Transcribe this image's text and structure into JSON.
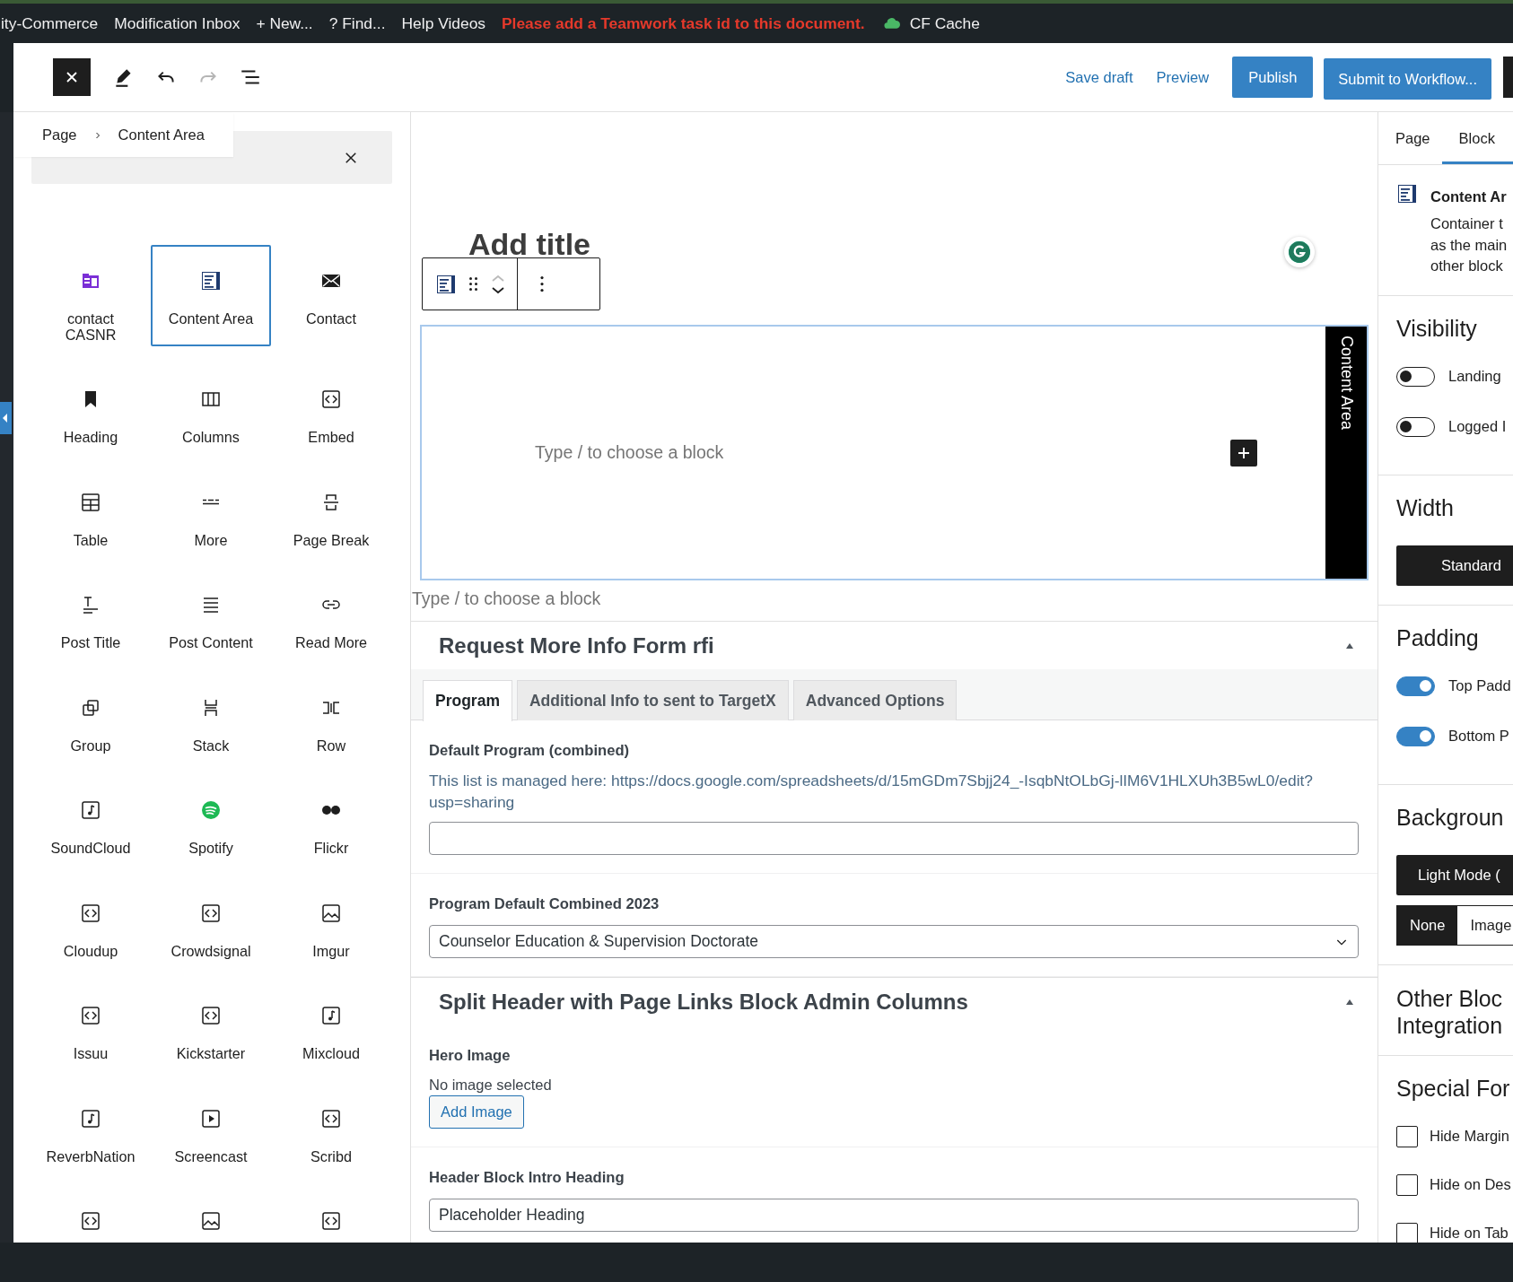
{
  "admin_bar": [
    {
      "kind": "link",
      "text": "ity-Commerce"
    },
    {
      "kind": "link",
      "text": "Modification Inbox"
    },
    {
      "kind": "link",
      "text": "+ New..."
    },
    {
      "kind": "link",
      "text": "? Find..."
    },
    {
      "kind": "link",
      "text": "Help Videos"
    },
    {
      "kind": "warning",
      "text": "Please add a Teamwork task id to this document."
    },
    {
      "kind": "cache",
      "text": "CF Cache"
    }
  ],
  "header": {
    "redo_disabled": true,
    "save_draft": "Save draft",
    "preview": "Preview",
    "publish": "Publish",
    "submit": "Submit to Workflow..."
  },
  "breadcrumb": [
    "Page",
    "Content Area"
  ],
  "inserter": {
    "items": [
      {
        "kind": "layout",
        "label": "contact CASNR",
        "selected": false
      },
      {
        "kind": "content-area",
        "label": "Content Area",
        "selected": true
      },
      {
        "kind": "envelope",
        "label": "Contact",
        "selected": false
      },
      {
        "kind": "bookmark",
        "label": "Heading",
        "selected": false
      },
      {
        "kind": "columns",
        "label": "Columns",
        "selected": false
      },
      {
        "kind": "embed",
        "label": "Embed",
        "selected": false
      },
      {
        "kind": "table",
        "label": "Table",
        "selected": false
      },
      {
        "kind": "more",
        "label": "More",
        "selected": false
      },
      {
        "kind": "page-break",
        "label": "Page Break",
        "selected": false
      },
      {
        "kind": "post-title",
        "label": "Post Title",
        "selected": false
      },
      {
        "kind": "post-content",
        "label": "Post Content",
        "selected": false
      },
      {
        "kind": "link",
        "label": "Read More",
        "selected": false
      },
      {
        "kind": "group",
        "label": "Group",
        "selected": false
      },
      {
        "kind": "stack",
        "label": "Stack",
        "selected": false
      },
      {
        "kind": "row",
        "label": "Row",
        "selected": false
      },
      {
        "kind": "audio",
        "label": "SoundCloud",
        "selected": false
      },
      {
        "kind": "spotify",
        "label": "Spotify",
        "selected": false
      },
      {
        "kind": "flickr",
        "label": "Flickr",
        "selected": false
      },
      {
        "kind": "embed",
        "label": "Cloudup",
        "selected": false
      },
      {
        "kind": "embed",
        "label": "Crowdsignal",
        "selected": false
      },
      {
        "kind": "image",
        "label": "Imgur",
        "selected": false
      },
      {
        "kind": "embed",
        "label": "Issuu",
        "selected": false
      },
      {
        "kind": "embed",
        "label": "Kickstarter",
        "selected": false
      },
      {
        "kind": "audio",
        "label": "Mixcloud",
        "selected": false
      },
      {
        "kind": "audio",
        "label": "ReverbNation",
        "selected": false
      },
      {
        "kind": "video",
        "label": "Screencast",
        "selected": false
      },
      {
        "kind": "embed",
        "label": "Scribd",
        "selected": false
      },
      {
        "kind": "embed",
        "selected": false
      },
      {
        "kind": "image",
        "selected": false
      },
      {
        "kind": "embed",
        "selected": false
      }
    ]
  },
  "editor": {
    "title_placeholder": "Add title",
    "block": {
      "label": "Content Area",
      "placeholder": "Type / to choose a block"
    },
    "appender_placeholder": "Type / to choose a block"
  },
  "metaboxes": [
    {
      "title": "Request More Info Form rfi",
      "expanded": true,
      "tabs": [
        {
          "label": "Program",
          "selected": true
        },
        {
          "label": "Additional Info to sent to TargetX",
          "selected": false
        },
        {
          "label": "Advanced Options",
          "selected": false
        }
      ],
      "fields": [
        {
          "kind": "text",
          "label": "Default Program (combined)",
          "description": "This list is managed here: https://docs.google.com/spreadsheets/d/15mGDm7Sbjj24_-IsqbNtOLbGj-lIM6V1HLXUh3B5wL0/edit?usp=sharing"
        },
        {
          "kind": "select",
          "label": "Program Default Combined 2023",
          "value": "Counselor Education & Supervision Doctorate"
        }
      ]
    },
    {
      "title": "Split Header with Page Links Block Admin Columns",
      "expanded": true,
      "fields": [
        {
          "kind": "image",
          "label": "Hero Image",
          "status": "No image selected",
          "button": "Add Image"
        },
        {
          "kind": "text",
          "label": "Header Block Intro Heading",
          "value": "Placeholder Heading"
        }
      ]
    }
  ],
  "sidebar": {
    "tabs": [
      {
        "label": "Page",
        "selected": false
      },
      {
        "label": "Block",
        "selected": true
      }
    ],
    "block_card": {
      "title": "Content Ar",
      "description_lines": [
        "Container t",
        "as the main",
        "other block"
      ]
    },
    "sections": [
      {
        "kind": "toggles",
        "title": "Visibility",
        "items": [
          {
            "label": "Landing",
            "on": false
          },
          {
            "label": "Logged I",
            "on": false
          }
        ]
      },
      {
        "kind": "button",
        "title": "Width",
        "button": "Standard"
      },
      {
        "kind": "toggles",
        "title": "Padding",
        "items": [
          {
            "label": "Top Padd",
            "on": true
          },
          {
            "label": "Bottom P",
            "on": true
          }
        ]
      },
      {
        "kind": "background",
        "title": "Backgroun",
        "button": "Light Mode (",
        "segments": [
          {
            "label": "None",
            "selected": true
          },
          {
            "label": "Image",
            "selected": false
          }
        ]
      },
      {
        "kind": "heading",
        "title_lines": [
          "Other Bloc",
          "Integration"
        ]
      },
      {
        "kind": "checkboxes",
        "title": "Special For",
        "items": [
          {
            "label": "Hide Margin",
            "checked": false
          },
          {
            "label": "Hide on Des",
            "checked": false
          },
          {
            "label": "Hide on Tab",
            "checked": false
          }
        ]
      }
    ]
  }
}
